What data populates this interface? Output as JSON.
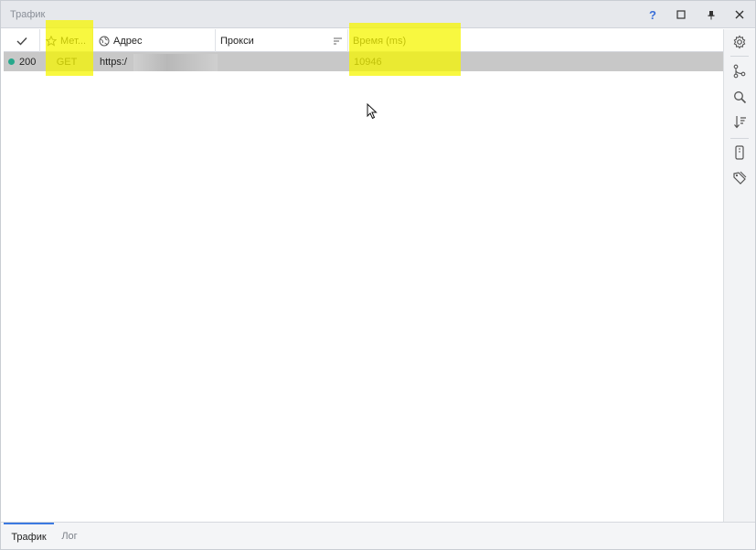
{
  "window": {
    "title": "Трафик",
    "help_label": "?"
  },
  "columns": {
    "method": "Мет...",
    "address": "Адрес",
    "proxy": "Прокси",
    "time": "Время (ms)"
  },
  "rows": [
    {
      "status": "200",
      "method": "GET",
      "address": "https:/",
      "proxy": "",
      "time": "10946"
    }
  ],
  "tabs": [
    {
      "label": "Трафик",
      "active": true
    },
    {
      "label": "Лог",
      "active": false
    }
  ],
  "right_toolbar": [
    "gear-icon",
    "branch-icon",
    "search-icon",
    "sort-icon",
    "phone-icon",
    "tag-icon"
  ],
  "colors": {
    "accent": "#3c7ae0",
    "status_ok": "#27a88c",
    "highlight": "#f5f500",
    "selected_row": "#c8c8c8"
  }
}
